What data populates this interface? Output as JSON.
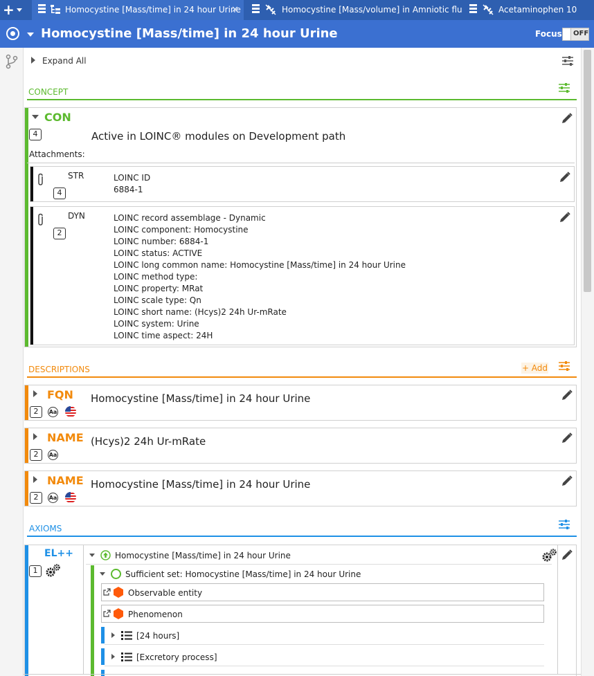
{
  "tabs": [
    {
      "label": "Homocystine [Mass/time] in 24 hour Urine",
      "active": true
    },
    {
      "label": "Homocystine [Mass/volume] in Amniotic fluid",
      "active": false
    },
    {
      "label": "Acetaminophen 10",
      "active": false
    }
  ],
  "title_bar": {
    "title": "Homocystine [Mass/time] in 24 hour Urine",
    "focus_label": "Focus",
    "focus_toggle": "OFF"
  },
  "toolbar": {
    "expand_all": "Expand All"
  },
  "concept": {
    "section_label": "CONCEPT",
    "type": "CON",
    "count": "4",
    "status": "Active in LOINC® modules on Development path",
    "attachments_label": "Attachments:",
    "attachments": [
      {
        "type": "STR",
        "count": "4",
        "lines": [
          "LOINC ID",
          "6884-1"
        ]
      },
      {
        "type": "DYN",
        "count": "2",
        "lines": [
          "LOINC record assemblage - Dynamic",
          "LOINC component: Homocystine",
          "LOINC number: 6884-1",
          "LOINC status: ACTIVE",
          "LOINC long common name: Homocystine [Mass/time] in 24 hour Urine",
          "LOINC method type:",
          "LOINC property: MRat",
          "LOINC scale type: Qn",
          "LOINC short name: (Hcys)2 24h Ur-mRate",
          "LOINC system: Urine",
          "LOINC time aspect: 24H"
        ]
      }
    ]
  },
  "descriptions": {
    "section_label": "DESCRIPTIONS",
    "add_label": "+ Add",
    "items": [
      {
        "type": "FQN",
        "count": "2",
        "text": "Homocystine [Mass/time] in 24 hour Urine",
        "flag": true
      },
      {
        "type": "NAME",
        "count": "2",
        "text": "(Hcys)2 24h Ur-mRate",
        "flag": false
      },
      {
        "type": "NAME",
        "count": "2",
        "text": "Homocystine [Mass/time] in 24 hour Urine",
        "flag": true
      }
    ]
  },
  "axioms": {
    "section_label": "AXIOMS",
    "logic_label": "EL++",
    "count": "1",
    "root": "Homocystine [Mass/time] in 24 hour Urine",
    "sufficient_set": "Sufficient set: Homocystine [Mass/time] in 24 hour Urine",
    "concepts": [
      "Observable entity",
      "Phenomenon"
    ],
    "roles": [
      "[24 hours]",
      "[Excretory process]"
    ]
  },
  "colors": {
    "tab_bar": "#2e5fb0",
    "title_bar": "#3b70d1",
    "concept_green": "#5cba2f",
    "description_orange": "#f28a0c",
    "axiom_blue": "#1e90e6"
  }
}
